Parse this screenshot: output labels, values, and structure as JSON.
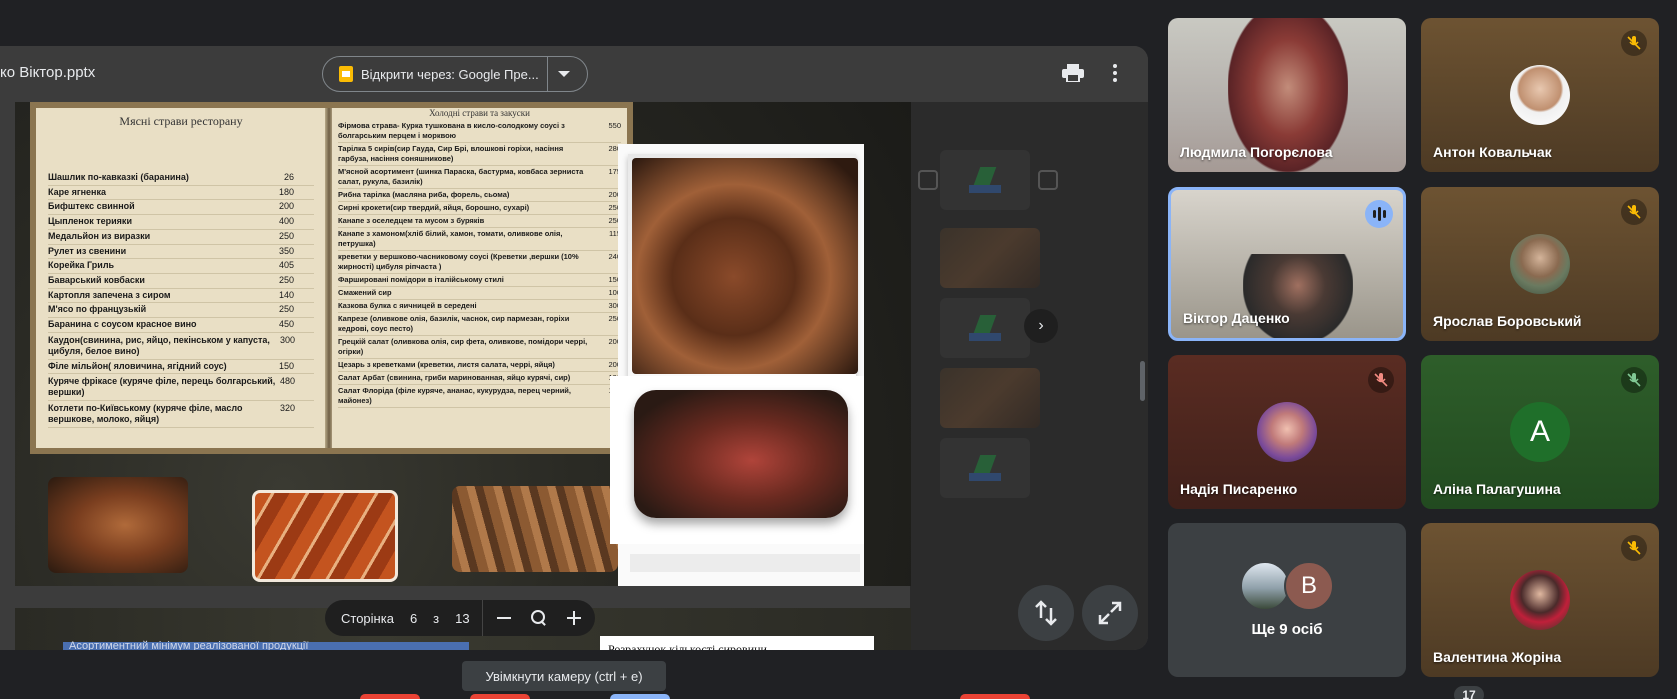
{
  "viewer": {
    "filename": "ко Віктор.pptx",
    "open_with_label": "Відкрити через: Google Пре...",
    "pager": {
      "label": "Сторінка",
      "current": "6",
      "of": "з",
      "total": "13"
    }
  },
  "slide": {
    "menu_left_title": "Мясні страви ресторану",
    "menu_left_items": [
      {
        "name": "Шашлик по-кавказкі (баранина)",
        "price": "26"
      },
      {
        "name": "Каре ягненка",
        "price": "180"
      },
      {
        "name": "Бифштекс свинной",
        "price": "200"
      },
      {
        "name": "Цыпленок терияки",
        "price": "400"
      },
      {
        "name": "Медальйон из виразки",
        "price": "250"
      },
      {
        "name": "Рулет из свенини",
        "price": "350"
      },
      {
        "name": "Корейка Гриль",
        "price": "405"
      },
      {
        "name": "Баварський ковбаски",
        "price": "250"
      },
      {
        "name": "Картопля запечена з сиром",
        "price": "140"
      },
      {
        "name": "М'ясо по французькій",
        "price": "250"
      },
      {
        "name": "Баранина с соусом красное вино",
        "price": "450"
      },
      {
        "name": "Каудон(свинина, рис, яйцо, пекінськом у капуста, цибуля, белое вино)",
        "price": "300"
      },
      {
        "name": "Філе мільйон( яловичина, ягідний соус)",
        "price": "150"
      },
      {
        "name": "Куряче фрікасе (куряче філе, перець болгарський, вершки)",
        "price": "480"
      },
      {
        "name": "Котлети по-Київському (куряче філе, масло вершкове, молоко, яйця)",
        "price": "320"
      }
    ],
    "menu_right_title": "Холодні страви та закуски",
    "menu_right_items": [
      {
        "name": "Фірмова страва- Курка тушкована в кисло-солодкому соусі з болгарським перцем і морквою",
        "price": "550"
      },
      {
        "name": "Тарілка 5 сирів(сир Гауда, Сир Брі, влошкові горіхи, насіння гарбуза, насіння соняшникове)",
        "price": "280"
      },
      {
        "name": "М'ясной асортимент (шинка Параска, бастурма, ковбаса зерниста салат, рукула, базилік)",
        "price": "175"
      },
      {
        "name": "Рибна тарілка (масляна риба, форель, сьома)",
        "price": "200"
      },
      {
        "name": "Сирні крокети(сир твердий, яйця, борошно, сухарі)",
        "price": "250"
      },
      {
        "name": "Канапе з оселедцем та мусом з буряків",
        "price": "250"
      },
      {
        "name": "Канапе з хамоном(хліб білий, хамон, томати, оливкове олія, петрушка)",
        "price": "115"
      },
      {
        "name": "креветки у вершково-часниковому соусі (Креветки ,вершки (10% жирності) цибуля ріпчаста )",
        "price": "240"
      },
      {
        "name": "Фаршировані помідори в італійському стилі",
        "price": "150"
      },
      {
        "name": "Смажений сир",
        "price": "100"
      },
      {
        "name": "Казкова булка с яичницей в середені",
        "price": "300"
      },
      {
        "name": "Капрезе (оливкове олія, базилік, часнок, сир пармезан, горіхи кедрові, соус песто)",
        "price": "250"
      },
      {
        "name": "Грецкій салат (оливкова олія, сир фета, оливкове, помідори черрі, огірки)",
        "price": "200"
      },
      {
        "name": "Цезарь з креветками (креветки, листя салата, черрі, яйця)",
        "price": "200"
      },
      {
        "name": "Салат Арбат (свинина, гриби маринованная, яйцо курячі, сир)",
        "price": "190"
      },
      {
        "name": "Салат Флоріда (філе куряче, ананас, кукурудза, перец черний, майонез)",
        "price": "190"
      }
    ],
    "next_slide_text": "Асортиментний мінімум реалізованої продукції",
    "next_slide_box": "Розрахунок кількості сировини"
  },
  "tooltip": "Увімкнути камеру (ctrl + e)",
  "participants": [
    {
      "name": "Людмила Погорєлова"
    },
    {
      "name": "Антон Ковальчак"
    },
    {
      "name": "Віктор Даценко"
    },
    {
      "name": "Ярослав Боровський"
    },
    {
      "name": "Надія Писаренко"
    },
    {
      "name": "Аліна Палагушина",
      "initial": "A"
    },
    {
      "name": "Валентина Жоріна"
    }
  ],
  "others": {
    "label": "Ще 9 осіб",
    "initial": "B"
  },
  "participant_count": "17",
  "colors": {
    "background": "#202124",
    "speaking": "#8ab4f8",
    "muted_tile": "#5c4530"
  }
}
